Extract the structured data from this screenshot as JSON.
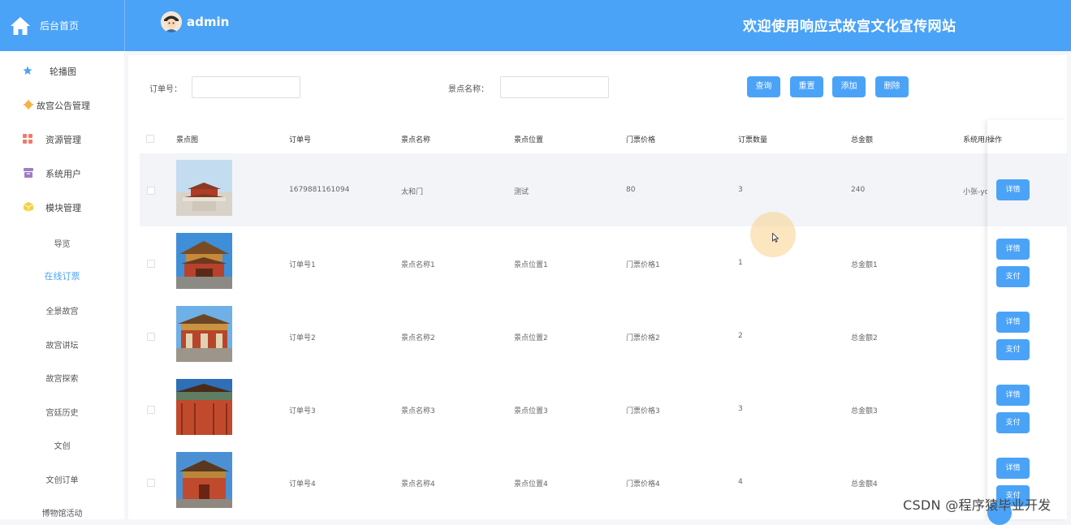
{
  "header": {
    "home_label": "后台首页",
    "username": "admin",
    "site_title": "欢迎使用响应式故宫文化宣传网站"
  },
  "sidebar": {
    "items": [
      {
        "label": "轮播图",
        "icon": "star-icon"
      },
      {
        "label": "故宫公告管理",
        "icon": "gear-icon"
      },
      {
        "label": "资源管理",
        "icon": "grid-icon"
      },
      {
        "label": "系统用户",
        "icon": "user-box-icon"
      },
      {
        "label": "模块管理",
        "icon": "cube-icon"
      }
    ],
    "sub_items": [
      "导览",
      "在线订票",
      "全景故宫",
      "故宫讲坛",
      "故宫探索",
      "宫廷历史",
      "文创",
      "文创订单",
      "博物馆活动"
    ],
    "active_sub": "在线订票"
  },
  "search": {
    "order_label": "订单号：",
    "order_value": "",
    "spot_label": "景点名称：",
    "spot_value": "",
    "query_label": "查询",
    "reset_label": "重置",
    "add_label": "添加",
    "delete_label": "删除"
  },
  "table": {
    "columns": [
      "景点图",
      "订单号",
      "景点名称",
      "景点位置",
      "门票价格",
      "订票数量",
      "总金额",
      "系统用户",
      "操作"
    ],
    "rows": [
      {
        "order": "1679881161094",
        "name": "太和门",
        "location": "测试",
        "price": "80",
        "qty": "3",
        "total": "240",
        "user": "小张-yo",
        "actions": [
          "详情"
        ]
      },
      {
        "order": "订单号1",
        "name": "景点名称1",
        "location": "景点位置1",
        "price": "门票价格1",
        "qty": "1",
        "total": "总金额1",
        "user": "",
        "actions": [
          "详情",
          "支付"
        ]
      },
      {
        "order": "订单号2",
        "name": "景点名称2",
        "location": "景点位置2",
        "price": "门票价格2",
        "qty": "2",
        "total": "总金额2",
        "user": "",
        "actions": [
          "详情",
          "支付"
        ]
      },
      {
        "order": "订单号3",
        "name": "景点名称3",
        "location": "景点位置3",
        "price": "门票价格3",
        "qty": "3",
        "total": "总金额3",
        "user": "",
        "actions": [
          "详情",
          "支付"
        ]
      },
      {
        "order": "订单号4",
        "name": "景点名称4",
        "location": "景点位置4",
        "price": "门票价格4",
        "qty": "4",
        "total": "总金额4",
        "user": "",
        "actions": [
          "详情",
          "支付"
        ]
      }
    ]
  },
  "watermark": "CSDN @程序猿毕业开发",
  "colors": {
    "primary": "#4ba3f7",
    "header": "#4ba3f7",
    "active": "#4ba3f7"
  }
}
